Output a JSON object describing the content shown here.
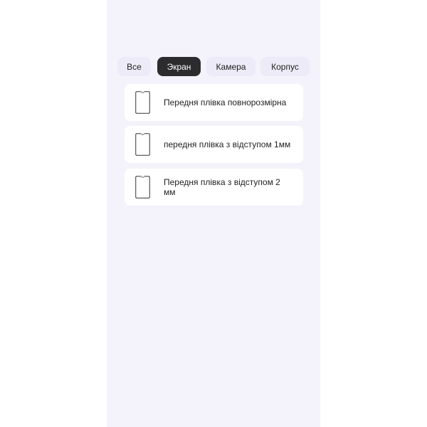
{
  "tabs": [
    {
      "label": "Все",
      "active": false
    },
    {
      "label": "Экран",
      "active": true
    },
    {
      "label": "Камера",
      "active": false
    },
    {
      "label": "Корпус",
      "active": false
    }
  ],
  "items": [
    {
      "label": "Передня плівка повнорозмірна",
      "icon": "phone-outline-icon"
    },
    {
      "label": "передня плівка з відступом 1мм",
      "icon": "phone-outline-icon"
    },
    {
      "label": "Передня плівка з відступом 2 мм",
      "icon": "phone-outline-icon"
    }
  ],
  "colors": {
    "background": "#f4f3fb",
    "tab_bg": "#ecebf7",
    "tab_active_bg": "#2c2c2e",
    "card_bg": "#ffffff",
    "text": "#1f1f1f"
  }
}
